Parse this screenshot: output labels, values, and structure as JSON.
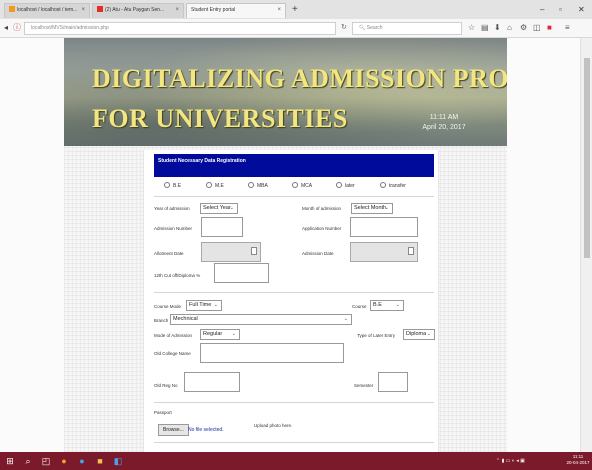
{
  "browser": {
    "tabs": [
      {
        "label": "localhost / localhost / tem..."
      },
      {
        "label": "(2) Atu - Atu Paygan Sen..."
      },
      {
        "label": "Student Entry portal"
      }
    ],
    "url": "localhost/MVS/main/admission.php",
    "search_placeholder": "Search",
    "win_min": "–",
    "win_max": "▫",
    "win_close": "✕"
  },
  "banner": {
    "line1": "DIGITALIZING ADMISSION PROCESS",
    "line2": "FOR UNIVERSITIES",
    "time": "11:11 AM",
    "date": "April 20, 2017"
  },
  "form": {
    "header": "Student Necessary Data Registration",
    "programs": [
      "B.E",
      "M.E",
      "MBA",
      "MCA",
      "later",
      "transfer"
    ],
    "year_label": "Year of admission",
    "year_value": "Select Year",
    "month_label": "Month of admission",
    "month_value": "Select Month",
    "admission_no_label": "Admission Number",
    "application_no_label": "Application Number",
    "allotment_label": "Allotment Date",
    "admission_date_label": "Admission Date",
    "cutoff_label": "12th Cut off/Diploma %",
    "course_mode_label": "Course Mode",
    "course_mode_value": "Full Time",
    "course_label": "Course",
    "course_value": "B.E",
    "branch_label": "Branch",
    "branch_value": "Mechnical",
    "mode_label": "Mode of Admission",
    "mode_value": "Regular",
    "later_entry_label": "Type of Later Entry",
    "later_entry_value": "Diploma",
    "old_college_label": "Old College Name",
    "old_reg_label": "Old Reg No",
    "semester_label": "Semester",
    "passport_label": "Passport",
    "browse_label": "Browse...",
    "no_file": "No file selected.",
    "upload_hint": "Upload photo here."
  },
  "taskbar": {
    "clock_time": "11:11",
    "clock_date": "20-04-2017"
  }
}
